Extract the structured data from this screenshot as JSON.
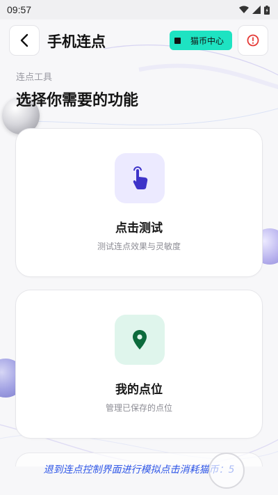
{
  "status_bar": {
    "time": "09:57",
    "icons": [
      "wifi-icon",
      "cellular-signal-icon",
      "battery-icon"
    ]
  },
  "header": {
    "back_icon": "chevron-left-icon",
    "title": "手机连点",
    "coin_center_label": "猫币中心",
    "coin_center_color": "#1ee3c2",
    "alert_icon": "alert-circle-icon",
    "alert_color": "#e53935"
  },
  "section": {
    "subtitle": "连点工具",
    "title": "选择你需要的功能"
  },
  "cards": [
    {
      "icon": "tap-finger-icon",
      "icon_color": "#3d33c9",
      "icon_bg": "#eceaff",
      "title": "点击测试",
      "description": "测试连点效果与灵敏度"
    },
    {
      "icon": "location-pin-icon",
      "icon_color": "#0c6b3c",
      "icon_bg": "#dff5ec",
      "title": "我的点位",
      "description": "管理已保存的点位"
    }
  ],
  "footer": {
    "note": "退到连点控制界面进行模拟点击消耗猫币：5",
    "note_color": "#2f57e8"
  }
}
